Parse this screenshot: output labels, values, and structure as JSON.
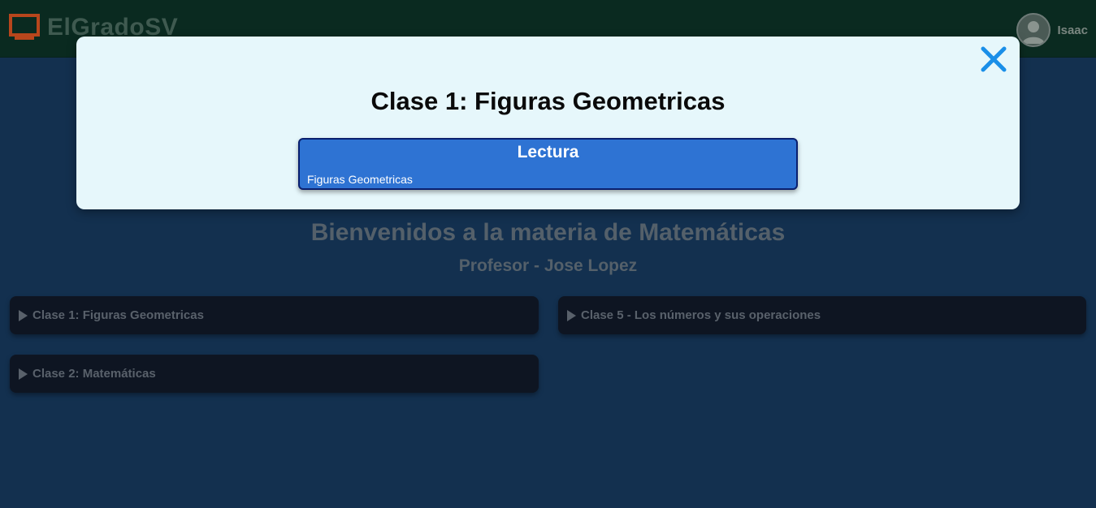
{
  "header": {
    "logo_icon": "chalkboard-icon",
    "brand": "ElGradoSV",
    "avatar_icon": "user-avatar-icon",
    "username": "Isaac"
  },
  "main": {
    "title": "Bienvenidos a la materia de Matemáticas",
    "subtitle": "Profesor - Jose Lopez",
    "classes": [
      {
        "label": "Clase 1: Figuras Geometricas"
      },
      {
        "label": "Clase 2: Matemáticas"
      },
      {
        "label": "Clase 5 - Los números y sus operaciones"
      }
    ]
  },
  "modal": {
    "title": "Clase 1: Figuras Geometricas",
    "close_icon": "close-icon",
    "lessons": [
      {
        "type": "Lectura",
        "name": "Figuras Geometricas"
      }
    ]
  },
  "colors": {
    "background": "#13304f",
    "header": "#0a2a20",
    "modal": "#e6f7fb",
    "lesson": "#2e73d3",
    "close": "#1a8fe8",
    "logo_accent": "#c0461a"
  }
}
